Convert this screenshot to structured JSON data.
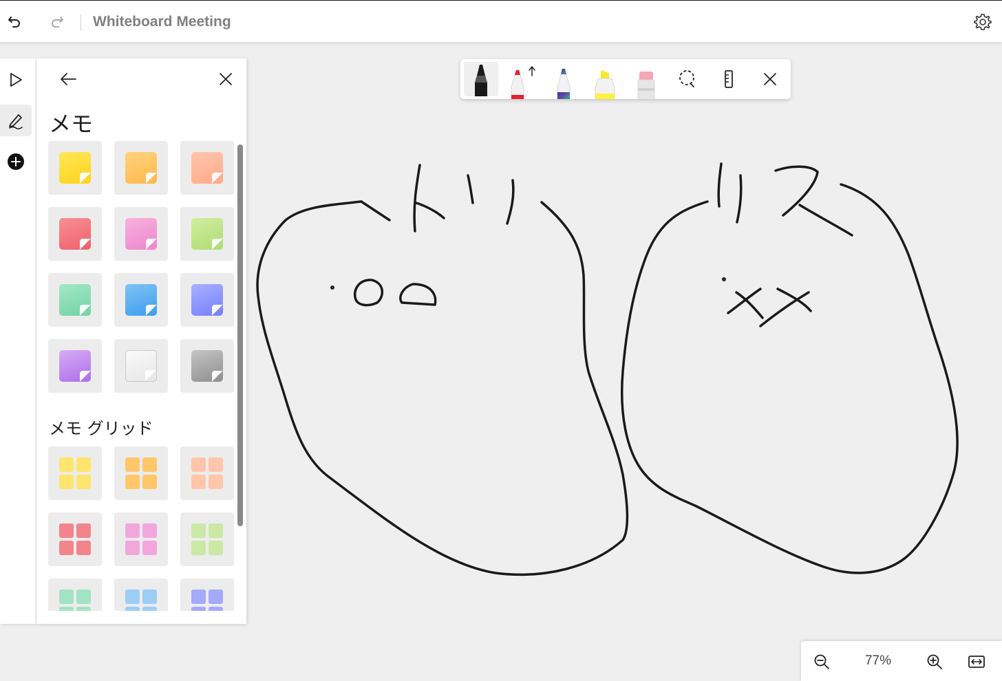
{
  "app": {
    "title": "Whiteboard Meeting"
  },
  "panel": {
    "section_notes": "メモ",
    "section_note_grids": "メモ グリッド",
    "note_colors": [
      "#ffdf3a",
      "#ffc76a",
      "#ffb89a",
      "#f77a80",
      "#f59ad6",
      "#bfe88a",
      "#88deb5",
      "#5bb1f2",
      "#8a93ff",
      "#c38ff2",
      "#f4f4f4",
      "#a8a8a8"
    ],
    "grid_colors": [
      "#ffe16a",
      "#ffc86f",
      "#ffc4a8",
      "#f2868d",
      "#f1a7dc",
      "#cbe8a5",
      "#a2e3c4",
      "#9ccdf5",
      "#a3aaf9"
    ]
  },
  "pen_tray": {
    "pens": [
      {
        "name": "black-pen",
        "color": "#1a1a1a"
      },
      {
        "name": "red-pen",
        "color": "#e8202d"
      },
      {
        "name": "galaxy-pen",
        "color": "#4a5fb5"
      },
      {
        "name": "yellow-highlighter",
        "color": "#fff23a"
      },
      {
        "name": "eraser",
        "color": "#f6a5b2"
      }
    ]
  },
  "zoom": {
    "level": "77%"
  },
  "colors": {
    "ink": "#1a1a1a",
    "canvas": "#efefef",
    "toolbar": "#ffffff"
  },
  "icons": [
    "undo-icon",
    "redo-icon",
    "settings-gear-icon",
    "select-pointer-icon",
    "pen-draw-icon",
    "add-circle-icon",
    "back-arrow-icon",
    "close-icon",
    "lasso-select-icon",
    "ruler-icon",
    "zoom-out-icon",
    "zoom-in-icon",
    "fit-to-screen-icon"
  ]
}
